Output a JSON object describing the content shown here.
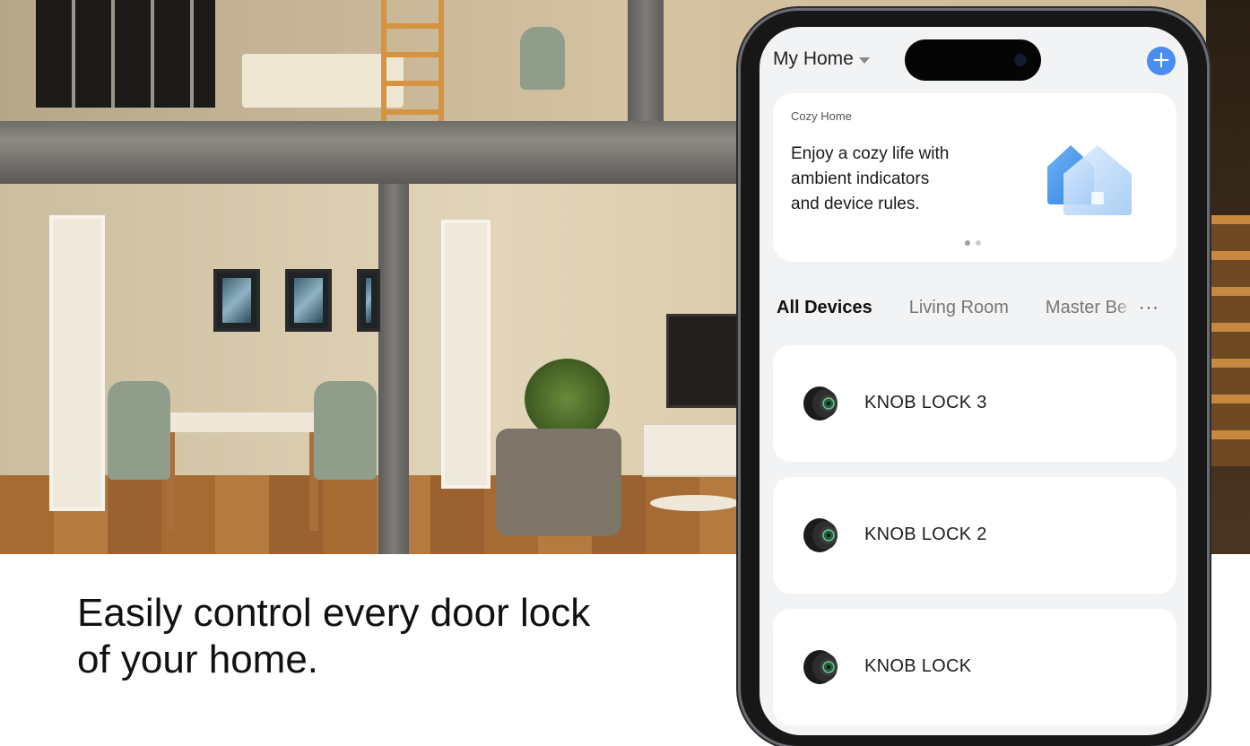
{
  "caption": {
    "line1": "Easily control every door lock",
    "line2": "of your home."
  },
  "app": {
    "home_selector": "My Home",
    "add_label": "+",
    "banner": {
      "title": "Cozy Home",
      "lines": [
        "Enjoy a cozy life with",
        "ambient indicators",
        "and device rules."
      ]
    },
    "tabs": [
      {
        "label": "All Devices",
        "active": true
      },
      {
        "label": "Living Room",
        "active": false
      },
      {
        "label": "Master Be",
        "active": false
      }
    ],
    "more_label": "···",
    "devices": [
      {
        "name": "KNOB LOCK 3",
        "icon": "knob-lock-icon"
      },
      {
        "name": "KNOB LOCK 2",
        "icon": "knob-lock-icon"
      },
      {
        "name": "KNOB LOCK",
        "icon": "knob-lock-icon"
      }
    ]
  },
  "colors": {
    "accent": "#4a8df0",
    "screen_bg": "#f2f3f5",
    "card_bg": "#ffffff"
  }
}
